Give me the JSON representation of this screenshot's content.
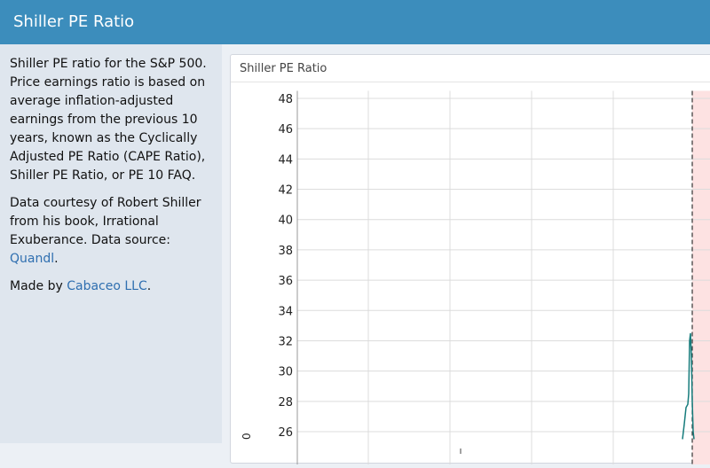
{
  "header": {
    "title": "Shiller PE Ratio"
  },
  "sidebar": {
    "para1": "Shiller PE ratio for the S&P 500. Price earnings ratio is based on average inflation-adjusted earnings from the previous 10 years, known as the Cyclically Adjusted PE Ratio (CAPE Ratio), Shiller PE Ratio, or PE 10 FAQ.",
    "para2_text": "Data courtesy of Robert Shiller from his book, Irrational Exuberance. Data source: ",
    "para2_link": "Quandl",
    "para2_end": ".",
    "para3_text": "Made by ",
    "para3_link": "Cabaceo LLC",
    "para3_end": "."
  },
  "panel": {
    "title": "Shiller PE Ratio"
  },
  "colors": {
    "header": "#3c8dbc",
    "line": "#167c7c",
    "shade": "#fde2e2",
    "link": "#2f6fb0"
  },
  "chart_data": {
    "type": "line",
    "title": "",
    "ylim": [
      25.5,
      48.5
    ],
    "yticks": [
      26,
      28,
      30,
      32,
      34,
      36,
      38,
      40,
      42,
      44,
      46,
      48
    ],
    "ytick_labels": [
      "26",
      "28",
      "30",
      "32",
      "34",
      "36",
      "38",
      "40",
      "42",
      "44",
      "46",
      "48"
    ],
    "y_label_partial": "0",
    "grid": true,
    "shaded_region": "right of dashed marker",
    "series": [
      {
        "values": [
          25.5,
          26.5,
          27.6,
          27.8,
          28.5,
          32.0,
          32.5,
          31.0,
          28.0,
          26.0,
          25.5
        ]
      }
    ]
  }
}
